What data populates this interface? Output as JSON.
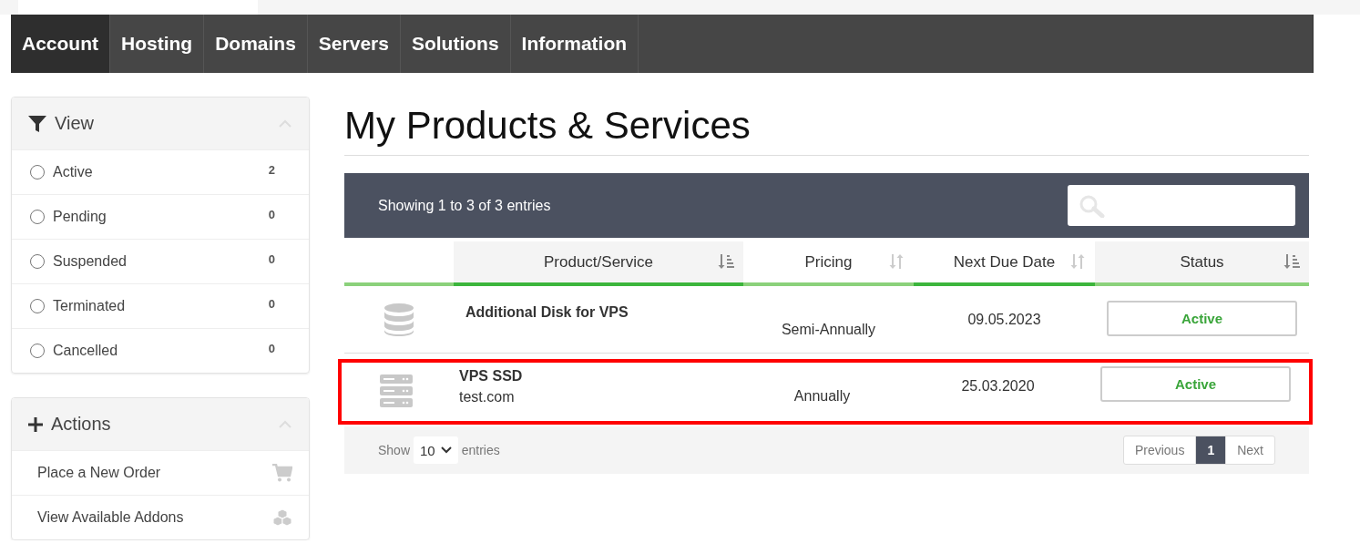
{
  "nav": {
    "items": [
      {
        "label": "Account",
        "selected": true
      },
      {
        "label": "Hosting",
        "selected": false
      },
      {
        "label": "Domains",
        "selected": false
      },
      {
        "label": "Servers",
        "selected": false
      },
      {
        "label": "Solutions",
        "selected": false
      },
      {
        "label": "Information",
        "selected": false
      }
    ]
  },
  "sidebar": {
    "view": {
      "title": "View",
      "expanded": true,
      "items": [
        {
          "label": "Active",
          "count": "2",
          "selected": false
        },
        {
          "label": "Pending",
          "count": "0",
          "selected": false
        },
        {
          "label": "Suspended",
          "count": "0",
          "selected": false
        },
        {
          "label": "Terminated",
          "count": "0",
          "selected": false
        },
        {
          "label": "Cancelled",
          "count": "0",
          "selected": false
        }
      ]
    },
    "actions": {
      "title": "Actions",
      "expanded": true,
      "items": [
        {
          "label": "Place a New Order",
          "kind": "cart"
        },
        {
          "label": "View Available Addons",
          "kind": "cubes"
        }
      ]
    }
  },
  "page_title": "My Products & Services",
  "table": {
    "info": "Showing 1 to 3 of 3 entries",
    "columns": [
      {
        "label": "Product/Service",
        "sorted": true,
        "selected": true
      },
      {
        "label": "Pricing",
        "sorted": false,
        "selected": false
      },
      {
        "label": "Next Due Date",
        "sorted": false,
        "selected": true
      },
      {
        "label": "Status",
        "sorted": true,
        "selected": false
      }
    ],
    "rows": [
      {
        "kind": "disk",
        "product": "Additional Disk for VPS",
        "pricing": "Semi-Annually",
        "due": "09.05.2023",
        "status": "Active",
        "highlighted": false
      },
      {
        "kind": "server",
        "product": "VPS SSD",
        "domain": "test.com",
        "pricing": "Annually",
        "due": "25.03.2020",
        "status": "Active",
        "highlighted": true
      }
    ],
    "length": {
      "prefix": "Show",
      "value": "10",
      "suffix": "entries"
    },
    "pagination": [
      {
        "label": "Previous",
        "selected": false
      },
      {
        "label": "1",
        "selected": true
      },
      {
        "label": "Next",
        "selected": false
      }
    ]
  }
}
